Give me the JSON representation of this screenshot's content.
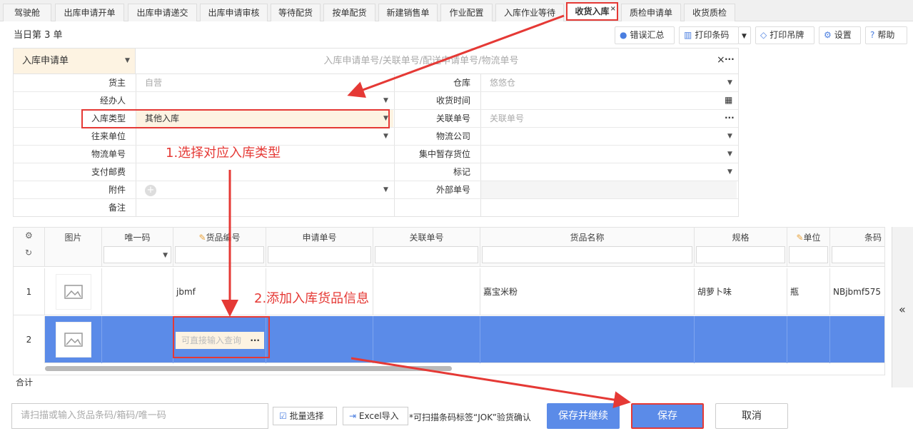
{
  "tabs": [
    {
      "label": "驾驶舱"
    },
    {
      "label": "出库申请开单"
    },
    {
      "label": "出库申请递交"
    },
    {
      "label": "出库申请审核"
    },
    {
      "label": "等待配货"
    },
    {
      "label": "按单配货"
    },
    {
      "label": "新建销售单"
    },
    {
      "label": "作业配置"
    },
    {
      "label": "入库作业等待"
    },
    {
      "label": "收货入库",
      "close": "×"
    },
    {
      "label": "质检申请单"
    },
    {
      "label": "收货质检"
    }
  ],
  "count_label": "当日第 3 单",
  "toolbar": {
    "error_summary": "错误汇总",
    "print_barcode": "打印条码",
    "print_tag": "打印吊牌",
    "settings": "设置",
    "help": "帮助"
  },
  "form": {
    "doc_type": "入库申请单",
    "search_placeholder": "入库申请单号/关联单号/配送申请单号/物流单号",
    "clear": "×",
    "more": "···",
    "owner_label": "货主",
    "owner_value": "自营",
    "warehouse_label": "仓库",
    "warehouse_value": "悠悠仓",
    "handler_label": "经办人",
    "receive_time_label": "收货时间",
    "type_label": "入库类型",
    "type_value": "其他入库",
    "related_no_label": "关联单号",
    "related_no_placeholder": "关联单号",
    "partner_label": "往来单位",
    "logistics_co_label": "物流公司",
    "logistics_no_label": "物流单号",
    "temp_loc_label": "集中暂存货位",
    "postage_label": "支付邮费",
    "mark_label": "标记",
    "attachment_label": "附件",
    "external_no_label": "外部单号",
    "remark_label": "备注"
  },
  "grid": {
    "columns": [
      "图片",
      "唯一码",
      "货品编号",
      "申请单号",
      "关联单号",
      "货品名称",
      "规格",
      "单位",
      "条码"
    ],
    "rows": [
      {
        "idx": "1",
        "code": "jbmf",
        "name": "嘉宝米粉",
        "spec": "胡萝卜味",
        "unit": "瓶",
        "barcode": "NBjbmf575"
      },
      {
        "idx": "2",
        "code_placeholder": "可直接输入查询",
        "more": "···"
      }
    ],
    "total_label": "合计",
    "collapse": "«"
  },
  "bottom": {
    "scan_placeholder": "请扫描或输入货品条码/箱码/唯一码",
    "batch_select": "批量选择",
    "excel_import": "Excel导入",
    "note": "*可扫描条码标签“JOK”验货确认",
    "save_continue": "保存并继续",
    "save": "保存",
    "cancel": "取消"
  },
  "annotations": {
    "step1": "1.选择对应入库类型",
    "step2": "2.添加入库货品信息"
  },
  "colors": {
    "accent": "#4a7ee0",
    "highlight_row": "#5b8be8",
    "annotation": "#e53935",
    "doc_type_bg": "#fdf3e2"
  }
}
